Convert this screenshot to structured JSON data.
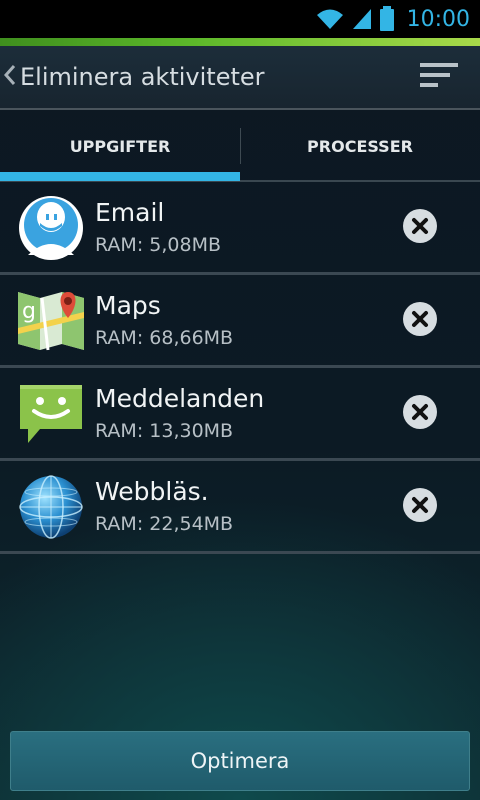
{
  "status_bar": {
    "time": "10:00",
    "icons": [
      "wifi-icon",
      "signal-icon",
      "battery-icon"
    ],
    "icon_color": "#33b5e5"
  },
  "action_bar": {
    "title": "Eliminera aktiviteter",
    "back_icon": "chevron-left-icon",
    "menu_icon": "sort-menu-icon"
  },
  "tabs": [
    {
      "label": "UPPGIFTER",
      "selected": true
    },
    {
      "label": "PROCESSER",
      "selected": false
    }
  ],
  "accent_color": "#33b5e5",
  "apps": [
    {
      "name": "Email",
      "ram": "RAM: 5,08MB",
      "icon": "email-app-icon"
    },
    {
      "name": "Maps",
      "ram": "RAM: 68,66MB",
      "icon": "maps-app-icon"
    },
    {
      "name": "Meddelanden",
      "ram": "RAM: 13,30MB",
      "icon": "messaging-app-icon"
    },
    {
      "name": "Webbläs.",
      "ram": "RAM: 22,54MB",
      "icon": "browser-app-icon"
    }
  ],
  "footer": {
    "optimize_label": "Optimera"
  }
}
